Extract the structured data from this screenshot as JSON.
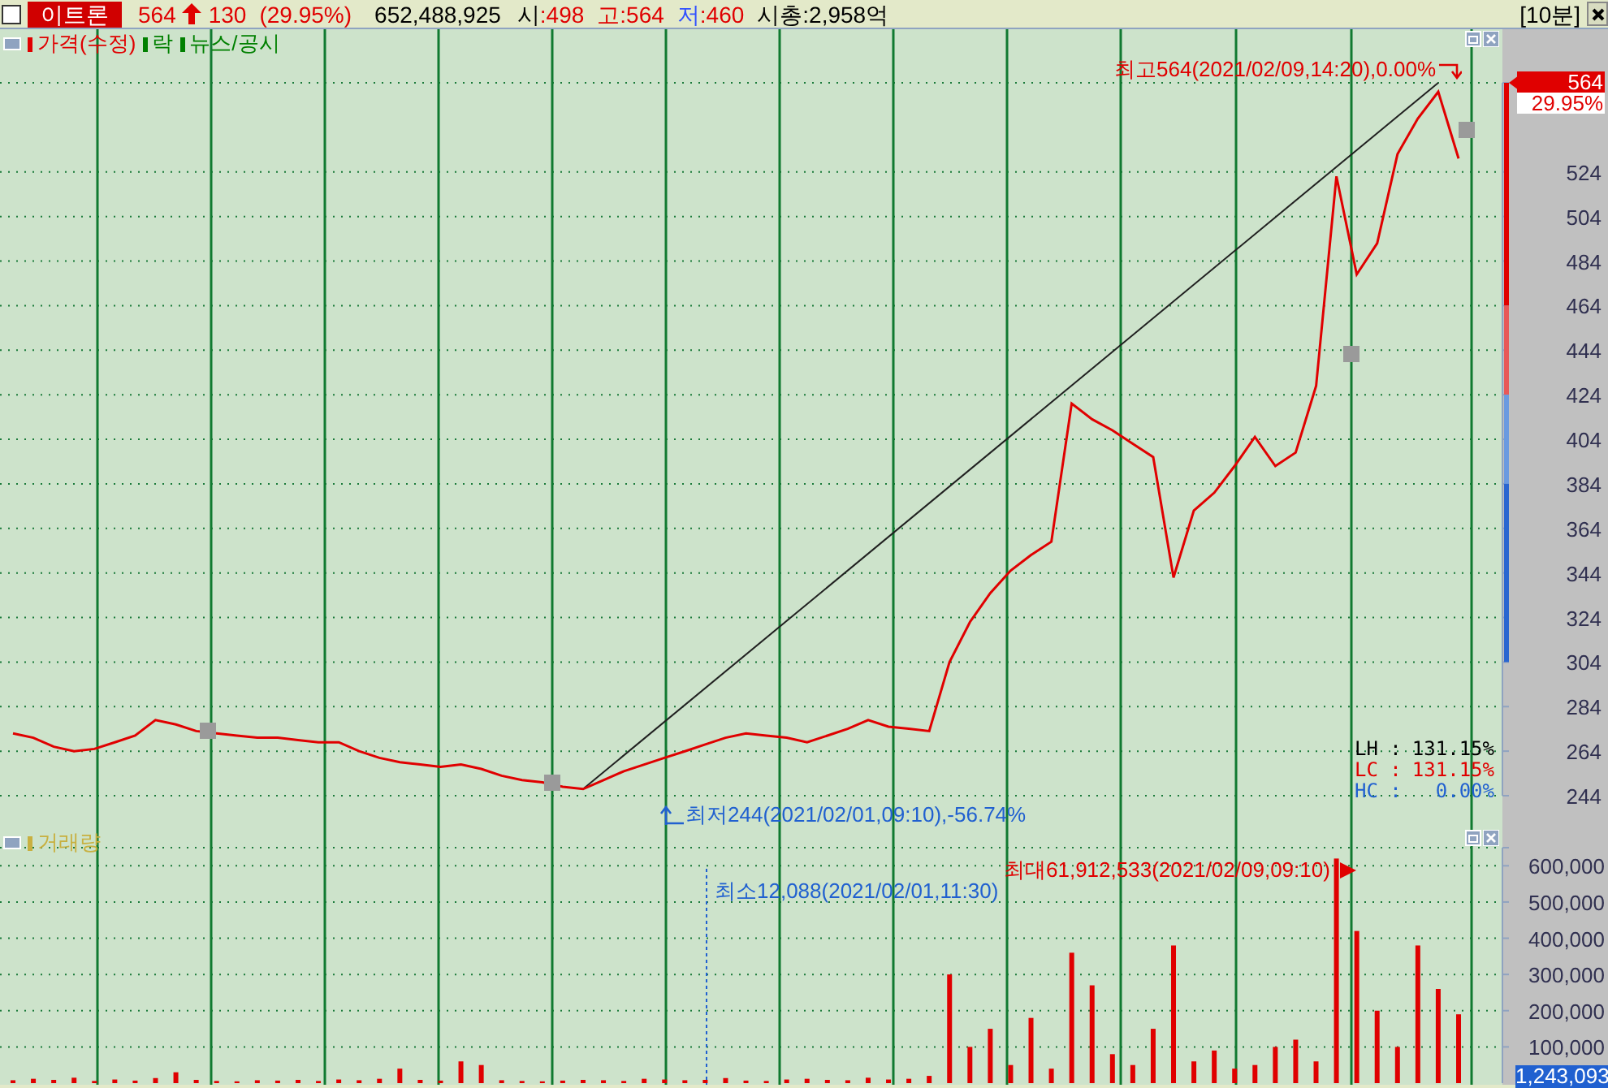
{
  "header": {
    "checked": false,
    "stock_name": "이트론",
    "price": "564",
    "change": "130",
    "change_rate": "(29.95%)",
    "volume": "652,488,925",
    "open_label": "시",
    "open_value": ":498",
    "high_label": "고",
    "high_value": ":564",
    "low_label": "저",
    "low_value": ":460",
    "market_cap": "시총:2,958억",
    "interval": "[10분]"
  },
  "price_panel": {
    "legend": [
      {
        "label": "가격(수정)",
        "color": "#e00000"
      },
      {
        "label": "락",
        "color": "#008000"
      },
      {
        "label": "뉴스/공시",
        "color": "#008000"
      }
    ],
    "current_price": "564",
    "current_change": "29.95%",
    "stats": [
      {
        "label": "LH :",
        "value": "131.15%",
        "color": "#000000"
      },
      {
        "label": "LC :",
        "value": "131.15%",
        "color": "#e00000"
      },
      {
        "label": "HC :",
        "value": "0.00%",
        "color": "#2060d0"
      }
    ],
    "chart_data": {
      "type": "line",
      "grid": true,
      "yticks": [
        244,
        264,
        284,
        304,
        324,
        344,
        364,
        384,
        404,
        424,
        444,
        464,
        484,
        504,
        524
      ],
      "ylim": [
        244,
        564
      ],
      "annotations": [
        {
          "text": "최고564(2021/02/09,14:20),0.00%"
        },
        {
          "text": "최저244(2021/02/01,09:10),-56.74%"
        }
      ],
      "series": [
        {
          "color": "#e00000",
          "values": [
            272,
            270,
            266,
            264,
            265,
            268,
            271,
            278,
            276,
            273,
            272,
            271,
            270,
            270,
            269,
            268,
            268,
            264,
            261,
            259,
            258,
            257,
            258,
            256,
            253,
            251,
            250,
            248,
            247,
            251,
            255,
            258,
            261,
            264,
            267,
            270,
            272,
            271,
            270,
            268,
            271,
            274,
            278,
            275,
            274,
            273,
            304,
            322,
            335,
            345,
            352,
            358,
            420,
            413,
            408,
            402,
            396,
            342,
            372,
            380,
            392,
            405,
            392,
            398,
            428,
            522,
            478,
            492,
            532,
            548,
            560,
            530
          ]
        }
      ]
    }
  },
  "volume_panel": {
    "legend": [
      {
        "label": "거래량",
        "color": "#c8b040"
      }
    ],
    "current_volume": "1,243,093",
    "chart_data": {
      "type": "bar",
      "grid": true,
      "ylim": [
        0,
        650000
      ],
      "yticks": [
        {
          "value": 100000,
          "label": "100,000"
        },
        {
          "value": 200000,
          "label": "200,000"
        },
        {
          "value": 300000,
          "label": "300,000"
        },
        {
          "value": 400000,
          "label": "400,000"
        },
        {
          "value": 500000,
          "label": "500,000"
        },
        {
          "value": 600000,
          "label": "600,000"
        }
      ],
      "annotations": [
        {
          "text": "최소12,088(2021/02/01,11:30)"
        },
        {
          "text": "최대61,912,533(2021/02/09,09:10)"
        }
      ],
      "series": [
        {
          "color": "#e00000",
          "values": [
            8000,
            12000,
            9000,
            15000,
            6000,
            10000,
            7000,
            14000,
            30000,
            9000,
            6000,
            5000,
            8000,
            7000,
            9000,
            6000,
            10000,
            8000,
            12000,
            40000,
            9000,
            7000,
            60000,
            50000,
            8000,
            6000,
            5000,
            7000,
            9000,
            8000,
            6000,
            12000,
            10000,
            8000,
            9000,
            14000,
            7000,
            6000,
            10000,
            12000,
            9000,
            8000,
            15000,
            10000,
            12000,
            20000,
            300000,
            100000,
            150000,
            50000,
            180000,
            40000,
            360000,
            270000,
            80000,
            50000,
            150000,
            380000,
            60000,
            90000,
            40000,
            50000,
            100000,
            120000,
            60000,
            620000,
            420000,
            200000,
            100000,
            380000,
            260000,
            190000
          ]
        }
      ]
    }
  }
}
